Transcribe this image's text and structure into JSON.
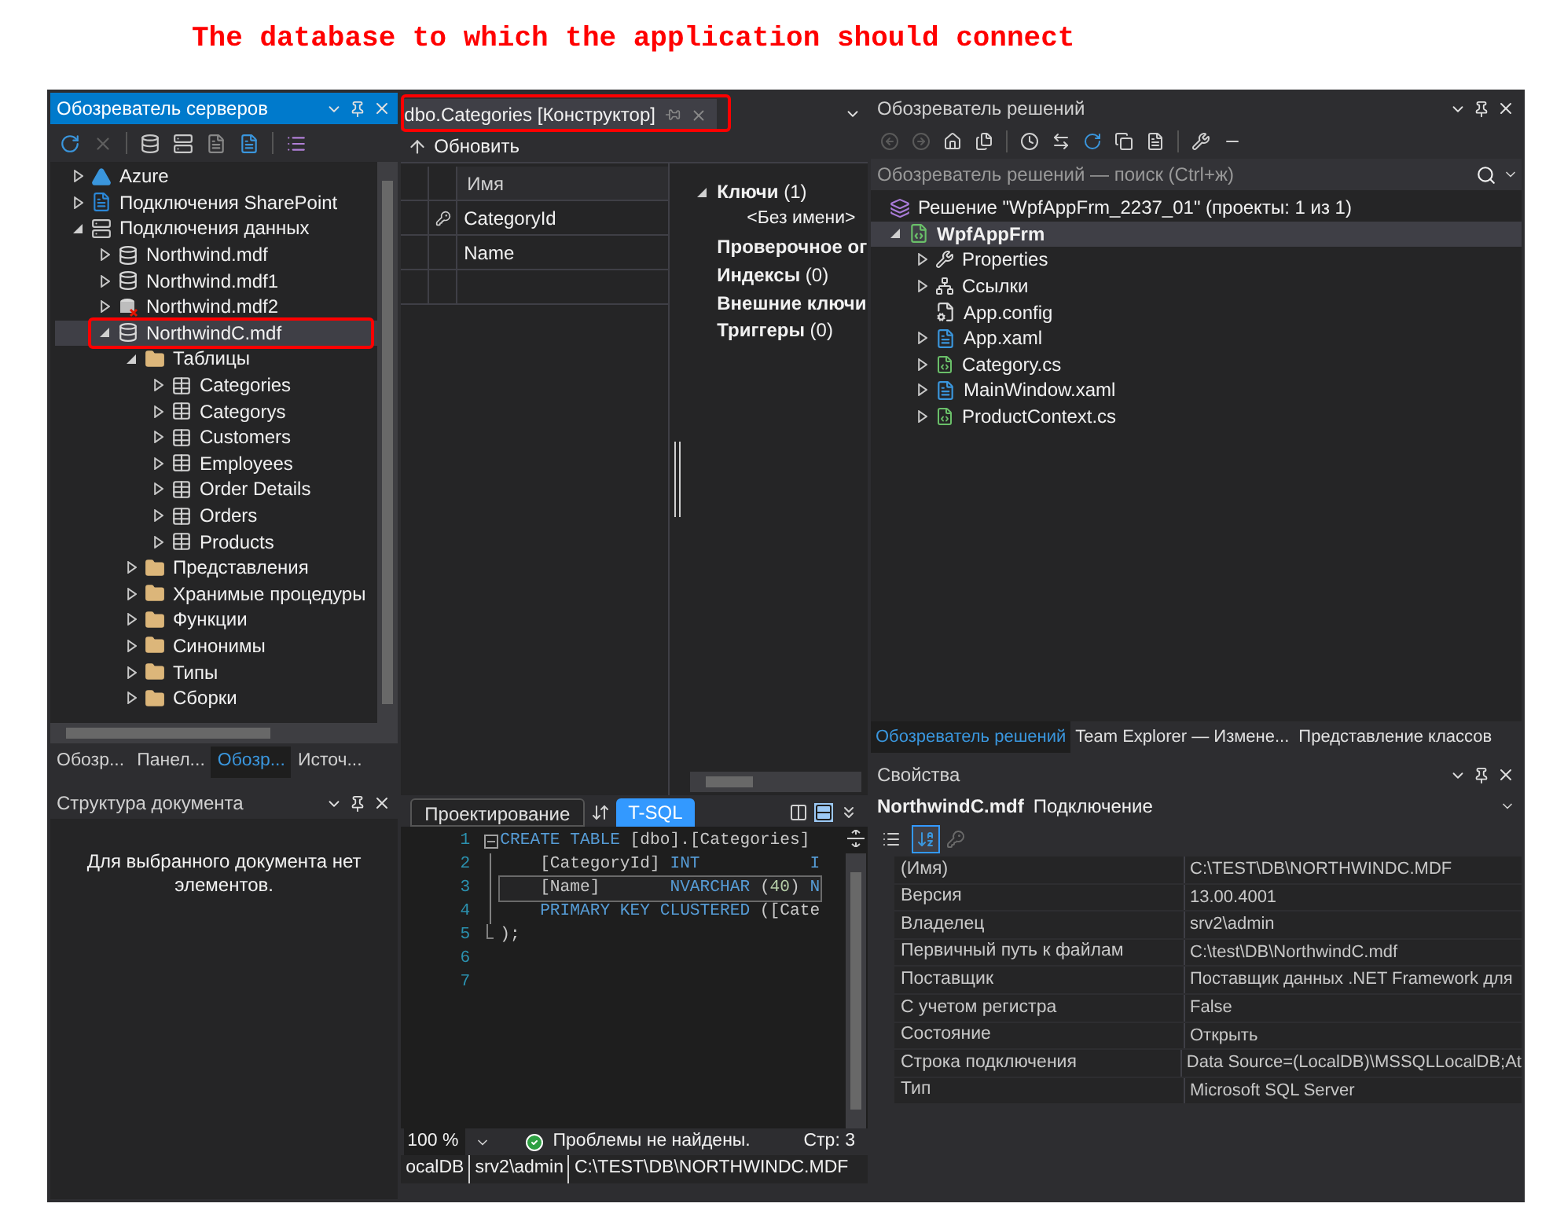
{
  "caption": "The database to which the application should connect",
  "server_explorer": {
    "title": "Обозреватель серверов",
    "active": true,
    "tree": [
      {
        "label": "Azure",
        "kind": "azure",
        "expanded": false,
        "selected": false,
        "outlined": false
      },
      {
        "label": "Подключения SharePoint",
        "kind": "sharepoint",
        "expanded": false,
        "selected": false,
        "outlined": false
      },
      {
        "label": "Подключения данных",
        "kind": "connections",
        "expanded": true,
        "selected": false,
        "outlined": false,
        "children": [
          {
            "label": "Northwind.mdf",
            "kind": "database",
            "expanded": false,
            "selected": false,
            "outlined": false
          },
          {
            "label": "Northwind.mdf1",
            "kind": "database",
            "expanded": false,
            "selected": false,
            "outlined": false
          },
          {
            "label": "Northwind.mdf2",
            "kind": "broken",
            "expanded": false,
            "selected": false,
            "outlined": false
          },
          {
            "label": "NorthwindC.mdf",
            "kind": "database",
            "expanded": true,
            "selected": true,
            "outlined": true,
            "children": [
              {
                "label": "Таблицы",
                "kind": "folder",
                "expanded": true,
                "selected": false,
                "outlined": false,
                "children": [
                  {
                    "label": "Categories",
                    "kind": "table",
                    "expanded": false,
                    "selected": false,
                    "outlined": false
                  },
                  {
                    "label": "Categorys",
                    "kind": "table",
                    "expanded": false,
                    "selected": false,
                    "outlined": false
                  },
                  {
                    "label": "Customers",
                    "kind": "table",
                    "expanded": false,
                    "selected": false,
                    "outlined": false
                  },
                  {
                    "label": "Employees",
                    "kind": "table",
                    "expanded": false,
                    "selected": false,
                    "outlined": false
                  },
                  {
                    "label": "Order Details",
                    "kind": "table",
                    "expanded": false,
                    "selected": false,
                    "outlined": false
                  },
                  {
                    "label": "Orders",
                    "kind": "table",
                    "expanded": false,
                    "selected": false,
                    "outlined": false
                  },
                  {
                    "label": "Products",
                    "kind": "table",
                    "expanded": false,
                    "selected": false,
                    "outlined": false
                  }
                ]
              },
              {
                "label": "Представления",
                "kind": "folder",
                "expanded": false,
                "selected": false,
                "outlined": false
              },
              {
                "label": "Хранимые процедуры",
                "kind": "folder",
                "expanded": false,
                "selected": false,
                "outlined": false
              },
              {
                "label": "Функции",
                "kind": "folder",
                "expanded": false,
                "selected": false,
                "outlined": false
              },
              {
                "label": "Синонимы",
                "kind": "folder",
                "expanded": false,
                "selected": false,
                "outlined": false
              },
              {
                "label": "Типы",
                "kind": "folder",
                "expanded": false,
                "selected": false,
                "outlined": false
              },
              {
                "label": "Сборки",
                "kind": "folder",
                "expanded": false,
                "selected": false,
                "outlined": false
              }
            ]
          }
        ]
      }
    ],
    "tabs": [
      {
        "label": "Обозр...",
        "selected": false
      },
      {
        "label": "Панел...",
        "selected": false
      },
      {
        "label": "Обозр...",
        "selected": true
      },
      {
        "label": "Источ...",
        "selected": false
      }
    ]
  },
  "document_outline": {
    "title": "Структура документа",
    "active": false,
    "message": "Для выбранного документа нет элементов."
  },
  "designer": {
    "tab_title": "dbo.Categories [Конструктор]",
    "outlined": true,
    "refresh_button": "Обновить",
    "grid": {
      "column": "Имя",
      "rows": [
        {
          "name": "CategoryId",
          "key": true
        },
        {
          "name": "Name",
          "key": false
        }
      ]
    },
    "keys_panel": [
      {
        "label": "Ключи",
        "count": "(1)",
        "kind": "group",
        "expanded": true
      },
      {
        "label": "<Без имени>",
        "kind": "item"
      },
      {
        "label": "Проверочное ог",
        "kind": "group",
        "expanded": false
      },
      {
        "label": "Индексы",
        "count": "(0)",
        "kind": "group",
        "expanded": false
      },
      {
        "label": "Внешние ключи",
        "kind": "group",
        "expanded": false
      },
      {
        "label": "Триггеры",
        "count": "(0)",
        "kind": "group",
        "expanded": false
      }
    ],
    "view_tabs": [
      {
        "label": "Проектирование",
        "selected": false
      },
      {
        "label": "T-SQL",
        "selected": true
      }
    ],
    "code": [
      {
        "number": "1",
        "kind": "start",
        "current": false,
        "tokens": [
          {
            "text": "CREATE TABLE",
            "kind": "keyword"
          },
          {
            "text": " [dbo].[Categories]",
            "kind": "plain"
          }
        ]
      },
      {
        "number": "2",
        "kind": "inside",
        "current": false,
        "tokens": [
          {
            "text": "    [CategoryId]",
            "kind": "plain"
          },
          {
            "text": " INT           I",
            "kind": "keyword"
          }
        ]
      },
      {
        "number": "3",
        "kind": "inside",
        "current": true,
        "tokens": [
          {
            "text": "    [Name]",
            "kind": "plain"
          },
          {
            "text": "       NVARCHAR ",
            "kind": "keyword"
          },
          {
            "text": "(",
            "kind": "plain"
          },
          {
            "text": "40",
            "kind": "number"
          },
          {
            "text": ")",
            "kind": "plain"
          },
          {
            "text": " N",
            "kind": "keyword"
          }
        ]
      },
      {
        "number": "4",
        "kind": "inside",
        "current": false,
        "tokens": [
          {
            "text": "    PRIMARY KEY CLUSTERED",
            "kind": "keyword"
          },
          {
            "text": " ([Cate",
            "kind": "plain"
          }
        ]
      },
      {
        "number": "5",
        "kind": "end",
        "current": false,
        "tokens": [
          {
            "text": ");",
            "kind": "plain"
          }
        ]
      },
      {
        "number": "6",
        "kind": "blank"
      },
      {
        "number": "7",
        "kind": "blank"
      }
    ],
    "status": {
      "zoom": "100 %",
      "message": "Проблемы не найдены.",
      "position": "Стр: 3"
    },
    "connection": [
      "ocalDB",
      "srv2\\admin",
      "C:\\TEST\\DB\\NORTHWINDC.MDF"
    ]
  },
  "solution_explorer": {
    "title": "Обозреватель решений",
    "active": false,
    "search_placeholder": "Обозреватель решений — поиск (Ctrl+ж)",
    "tree": [
      {
        "label": "Решение \"WpfAppFrm_2237_01\" (проекты: 1 из 1)",
        "kind": "solution",
        "expandable": false,
        "selected": false,
        "children": [
          {
            "label": "WpfAppFrm",
            "kind": "project",
            "expandable": true,
            "expanded": true,
            "selected": true,
            "children": [
              {
                "label": "Properties",
                "kind": "wrench",
                "expandable": true,
                "expanded": false,
                "selected": false
              },
              {
                "label": "Ссылки",
                "kind": "references",
                "expandable": true,
                "expanded": false,
                "selected": false
              },
              {
                "label": "App.config",
                "kind": "config",
                "expandable": false,
                "selected": false
              },
              {
                "label": "App.xaml",
                "kind": "xaml",
                "expandable": true,
                "expanded": false,
                "selected": false
              },
              {
                "label": "Category.cs",
                "kind": "csharp",
                "expandable": true,
                "expanded": false,
                "selected": false
              },
              {
                "label": "MainWindow.xaml",
                "kind": "xaml",
                "expandable": true,
                "expanded": false,
                "selected": false
              },
              {
                "label": "ProductContext.cs",
                "kind": "csharp",
                "expandable": true,
                "expanded": false,
                "selected": false
              }
            ]
          }
        ]
      }
    ],
    "tabs": [
      {
        "label": "Обозреватель решений",
        "selected": true
      },
      {
        "label": "Team Explorer — Измене...",
        "selected": false
      },
      {
        "label": "Представление классов",
        "selected": false
      }
    ]
  },
  "properties": {
    "title": "Свойства",
    "active": false,
    "object_name": "NorthwindC.mdf",
    "object_type": "Подключение",
    "view_buttons": [
      {
        "kind": "categorized",
        "selected": false
      },
      {
        "kind": "alphabetical",
        "selected": true
      }
    ],
    "rows": [
      {
        "name": "(Имя)",
        "value": "C:\\TEST\\DB\\NORTHWINDC.MDF"
      },
      {
        "name": "Версия",
        "value": "13.00.4001"
      },
      {
        "name": "Владелец",
        "value": "srv2\\admin"
      },
      {
        "name": "Первичный путь к файлам",
        "value": "C:\\test\\DB\\NorthwindC.mdf"
      },
      {
        "name": "Поставщик",
        "value": "Поставщик данных .NET Framework для"
      },
      {
        "name": "С учетом регистра",
        "value": "False"
      },
      {
        "name": "Состояние",
        "value": "Открыть"
      },
      {
        "name": "Строка подключения",
        "value": "Data Source=(LocalDB)\\MSSQLLocalDB;At"
      },
      {
        "name": "Тип",
        "value": "Microsoft SQL Server"
      }
    ]
  }
}
